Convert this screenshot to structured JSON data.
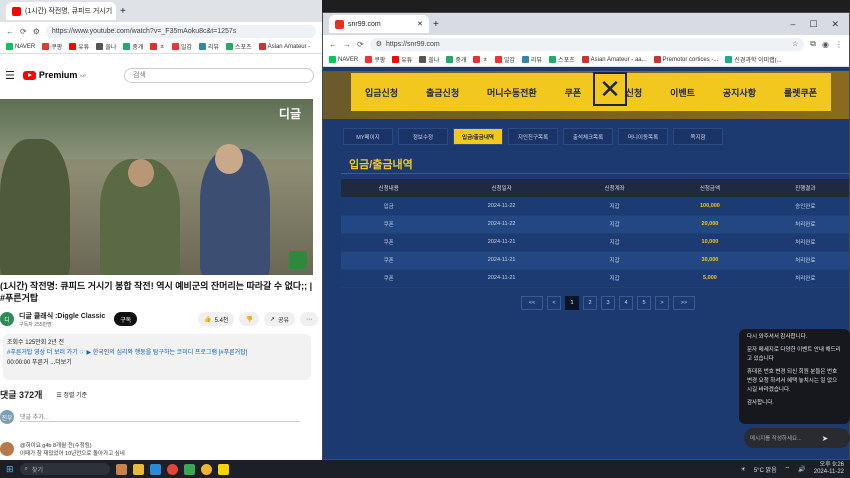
{
  "left_browser": {
    "tab_title": "(1시간) 작전명, 큐피드 거시기",
    "new_tab_icon": "plus-icon",
    "url": "https://www.youtube.com/watch?v=_F35mAoku8c&t=1257s",
    "bookmarks": [
      "NAVER",
      "쿠팡",
      "유튜",
      "쏠나",
      "중개",
      "ㅊ",
      "일감",
      "리뷰",
      "스포츠",
      "Asian Amateur -"
    ],
    "youtube": {
      "logo_text": "Premium",
      "logo_sup": "KR",
      "search_placeholder": "검색",
      "video_badge": "디글",
      "video_title": "(1시간) 작전명: 큐피드 거시기 봉합 작전! 역시 예비군의 잔머리는 따라갈 수 없다;; | #푸른거탑",
      "hashtag": "#푸른거탑",
      "channel_name": "디글 클래식 :Diggle Classic",
      "subscribers": "구독자 255만명",
      "subscribe_label": "구독",
      "likes": "5.4천",
      "share_label": "공유",
      "desc_line1": "조회수 125만회 2년 전",
      "desc_line2": "#푸른거탑 영상 더 보러 가기 ☞ ▶ 한국인의 심리와 행동을 탐구하는 코미디 프로그램 [#푸른거탑]",
      "desc_line3": "00:00:00 푸른거 ...더보기",
      "comments_count": "댓글 372개",
      "sort_label": "정렬 기준",
      "comment_placeholder": "댓글 추가...",
      "avatar_text": "진우",
      "comment_author": "@하이요 g4b 8개월 전(수정됨)",
      "comment_text": "이때가 참 재밌었어 10년전으로 돌아가고 싶네"
    }
  },
  "right_browser": {
    "tab_title": "snr99.com",
    "url": "https://snr99.com",
    "bookmarks": [
      "NAVER",
      "쿠팡",
      "유튜",
      "쏠나",
      "중개",
      "ㅊ",
      "일감",
      "리뷰",
      "스포츠",
      "Asian Amateur - aa...",
      "Premotor cortices -...",
      "신경과학 이미랩(..."
    ],
    "main_menu": [
      "입금신청",
      "출금신청",
      "머니수동전환",
      "쿠폰",
      "콤프신청",
      "이벤트",
      "공지사항",
      "룰렛쿠폰"
    ],
    "sub_tabs": [
      "MY페이지",
      "정보수정",
      "입금/출금내역",
      "지인친구목록",
      "출석체크목록",
      "머니이동목록",
      "쪽지함"
    ],
    "active_sub_tab": 2,
    "page_title": "입금/출금내역",
    "table": {
      "headers": [
        "신청내용",
        "신청일자",
        "신청계좌",
        "신청금액",
        "진행결과"
      ],
      "rows": [
        [
          "입금",
          "2024-11-22",
          "지갑",
          "100,000",
          "승인완료"
        ],
        [
          "쿠폰",
          "2024-11-22",
          "지갑",
          "20,000",
          "처리완료"
        ],
        [
          "쿠폰",
          "2024-11-21",
          "지갑",
          "10,000",
          "처리완료"
        ],
        [
          "쿠폰",
          "2024-11-21",
          "지갑",
          "30,000",
          "처리완료"
        ],
        [
          "쿠폰",
          "2024-11-21",
          "지갑",
          "5,000",
          "처리완료"
        ]
      ]
    },
    "pagination": [
      "<<",
      "<",
      "1",
      "2",
      "3",
      "4",
      "5",
      ">",
      ">>"
    ],
    "current_page": "1",
    "chat": {
      "line1": "다시 와주셔서 감사합니다.",
      "line2": "문자 메세지로 다양한 이벤트 안내 해드리고 있습니다",
      "line3": "휴대폰 번호 변경 되신 회원 분들은 번호 변경 요청 하셔서 혜택 놓치시는 일 없으시길 바라겠습니다.",
      "line4": "감사합니다.",
      "input_placeholder": "메시지를 작성하세요..."
    }
  },
  "taskbar": {
    "search_label": "찾기",
    "weather": "5°C 맑음",
    "time": "오후 9:26",
    "date": "2024-11-22"
  }
}
